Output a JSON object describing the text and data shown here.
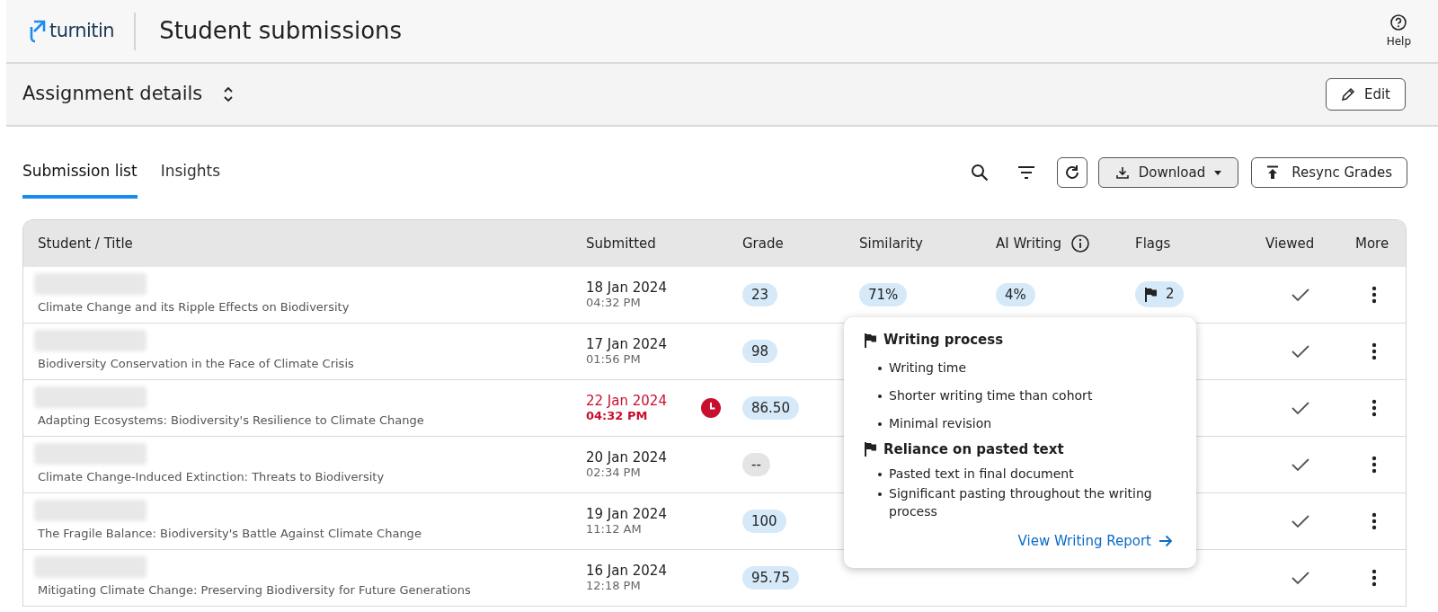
{
  "header": {
    "logo": "turnitin",
    "title": "Student submissions",
    "help": "Help"
  },
  "assignment": {
    "title": "Assignment details",
    "edit": "Edit"
  },
  "tabs": [
    {
      "label": "Submission list",
      "selected": true
    },
    {
      "label": "Insights",
      "selected": false
    }
  ],
  "toolbar": {
    "download": "Download",
    "resync": "Resync Grades"
  },
  "table": {
    "columns": [
      "Student / Title",
      "Submitted",
      "Grade",
      "Similarity",
      "AI Writing",
      "Flags",
      "Viewed",
      "More"
    ],
    "rows": [
      {
        "title": "Climate Change and its Ripple Effects on Biodiversity",
        "date": "18 Jan 2024",
        "time": "04:32 PM",
        "late": false,
        "grade": "23",
        "graded": true,
        "similarity": "71%",
        "ai_writing": "4%",
        "flags": "2",
        "viewed": true
      },
      {
        "title": "Biodiversity Conservation in the Face of Climate Crisis",
        "date": "17 Jan 2024",
        "time": "01:56 PM",
        "late": false,
        "grade": "98",
        "graded": true,
        "viewed": true
      },
      {
        "title": "Adapting Ecosystems: Biodiversity's Resilience to Climate Change",
        "date": "22 Jan 2024",
        "time": "04:32 PM",
        "late": true,
        "grade": "86.50",
        "graded": true,
        "viewed": true
      },
      {
        "title": "Climate Change-Induced Extinction: Threats to Biodiversity",
        "date": "20 Jan 2024",
        "time": "02:34 PM",
        "late": false,
        "grade": "--",
        "graded": false,
        "viewed": true
      },
      {
        "title": "The Fragile Balance: Biodiversity's Battle Against Climate Change",
        "date": "19 Jan 2024",
        "time": "11:12 AM",
        "late": false,
        "grade": "100",
        "graded": true,
        "viewed": true
      },
      {
        "title": "Mitigating Climate Change: Preserving Biodiversity for Future Generations",
        "date": "16 Jan 2024",
        "time": "12:18 PM",
        "late": false,
        "grade": "95.75",
        "graded": true,
        "viewed": true
      }
    ]
  },
  "popover": {
    "sections": [
      {
        "title": "Writing process",
        "items": [
          "Writing time",
          "Shorter writing time than cohort",
          "Minimal revision"
        ],
        "spaced": true
      },
      {
        "title": "Reliance on pasted text",
        "items": [
          "Pasted text in final document",
          "Significant pasting throughout the writing process"
        ],
        "spaced": false
      }
    ],
    "link": "View Writing Report"
  }
}
